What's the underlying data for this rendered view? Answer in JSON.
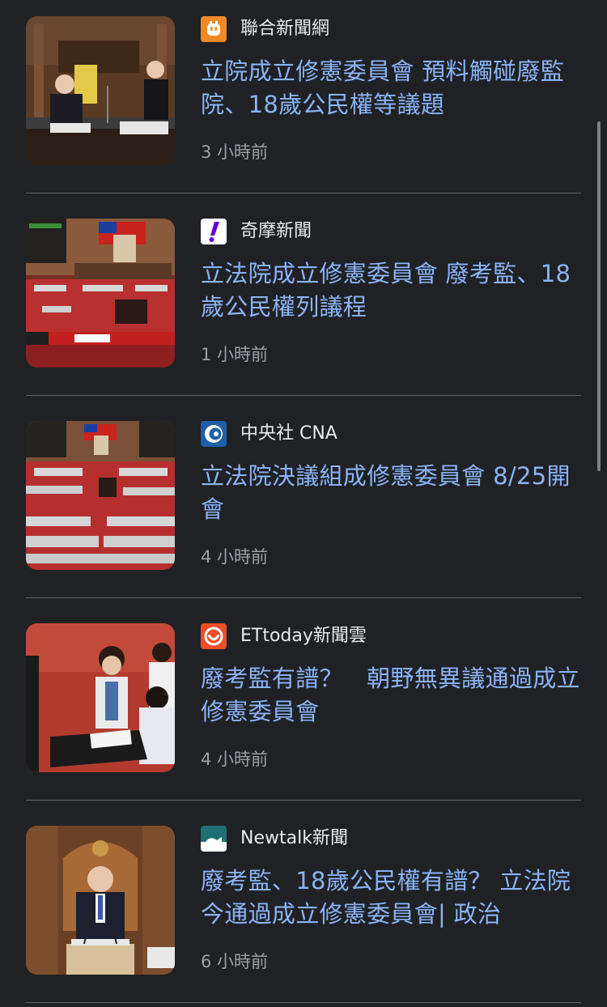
{
  "articles": [
    {
      "source": "聯合新聞網",
      "source_icon": "udn-logo-icon",
      "source_color": "#f08a24",
      "headline": "立院成立修憲委員會 預料觸碰廢監院、18歲公民權等議題",
      "time": "3 小時前",
      "thumbnail": "legislative-speaker-podium-image"
    },
    {
      "source": "奇摩新聞",
      "source_icon": "yahoo-logo-icon",
      "source_color": "#6001d2",
      "headline": "立法院成立修憲委員會 廢考監、18歲公民權列議程",
      "time": "1 小時前",
      "thumbnail": "legislative-chamber-broadcast-image"
    },
    {
      "source": "中央社 CNA",
      "source_icon": "cna-logo-icon",
      "source_color": "#1d5fa8",
      "headline": "立法院決議組成修憲委員會 8/25開會",
      "time": "4 小時前",
      "thumbnail": "legislative-chamber-overview-image"
    },
    {
      "source": "ETtoday新聞雲",
      "source_icon": "ettoday-logo-icon",
      "source_color": "#ea4f25",
      "headline": "廢考監有譜？　朝野無異議通過成立修憲委員會",
      "time": "4 小時前",
      "thumbnail": "legislators-voting-image"
    },
    {
      "source": "Newtalk新聞",
      "source_icon": "newtalk-logo-icon",
      "source_color": "#1f6f73",
      "headline": "廢考監、18歲公民權有譜？ 立法院今通過成立修憲委員會| 政治",
      "time": "6 小時前",
      "thumbnail": "speaker-at-lectern-image"
    }
  ]
}
